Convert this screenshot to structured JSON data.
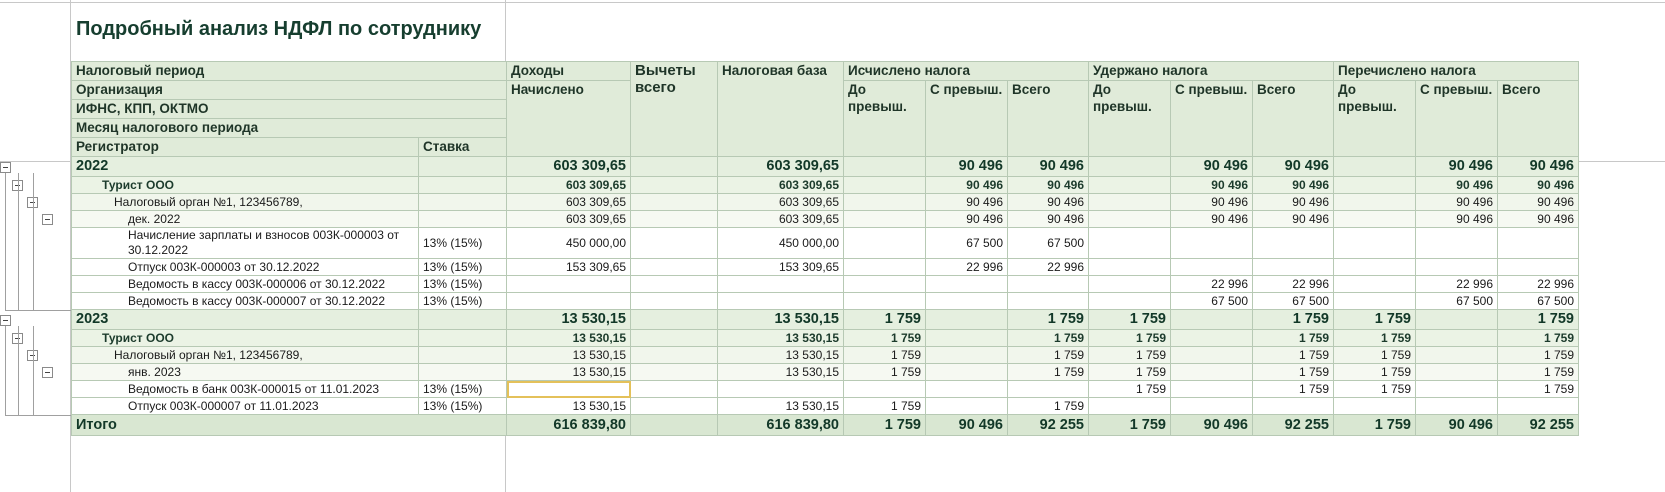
{
  "report": {
    "title": "Подробный анализ НДФЛ по сотруднику"
  },
  "headers": {
    "tax_period": "Налоговый период",
    "organization": "Организация",
    "ifns": "ИФНС, КПП, ОКТМО",
    "month": "Месяц налогового периода",
    "registrar": "Регистратор",
    "rate": "Ставка",
    "income": "Доходы",
    "accrued": "Начислено",
    "deductions": "Вычеты всего",
    "tax_base": "Налоговая база",
    "calculated": "Исчислено налога",
    "withheld": "Удержано налога",
    "transferred": "Перечислено налога",
    "before_excess": "До превыш.",
    "over_excess": "С превыш.",
    "total": "Всего"
  },
  "rows": [
    {
      "type": "lvl0",
      "label": "2022",
      "rate": "",
      "income": "603 309,65",
      "ded": "",
      "base": "603 309,65",
      "c1": "",
      "c2": "90 496",
      "c3": "90 496",
      "w1": "",
      "w2": "90 496",
      "w3": "90 496",
      "t1": "",
      "t2": "90 496",
      "t3": "90 496"
    },
    {
      "type": "lvl1",
      "label": "Турист ООО",
      "rate": "",
      "income": "603 309,65",
      "ded": "",
      "base": "603 309,65",
      "c1": "",
      "c2": "90 496",
      "c3": "90 496",
      "w1": "",
      "w2": "90 496",
      "w3": "90 496",
      "t1": "",
      "t2": "90 496",
      "t3": "90 496"
    },
    {
      "type": "lvl2",
      "label": "Налоговый орган №1, 123456789,",
      "rate": "",
      "income": "603 309,65",
      "ded": "",
      "base": "603 309,65",
      "c1": "",
      "c2": "90 496",
      "c3": "90 496",
      "w1": "",
      "w2": "90 496",
      "w3": "90 496",
      "t1": "",
      "t2": "90 496",
      "t3": "90 496"
    },
    {
      "type": "lvl3",
      "label": "дек. 2022",
      "rate": "",
      "income": "603 309,65",
      "ded": "",
      "base": "603 309,65",
      "c1": "",
      "c2": "90 496",
      "c3": "90 496",
      "w1": "",
      "w2": "90 496",
      "w3": "90 496",
      "t1": "",
      "t2": "90 496",
      "t3": "90 496"
    },
    {
      "type": "rowd",
      "label": "Начисление зарплаты и взносов 003К-000003 от 30.12.2022",
      "rate": "13% (15%)",
      "income": "450 000,00",
      "ded": "",
      "base": "450 000,00",
      "c1": "",
      "c2": "67 500",
      "c3": "67 500",
      "w1": "",
      "w2": "",
      "w3": "",
      "t1": "",
      "t2": "",
      "t3": ""
    },
    {
      "type": "rowd",
      "label": "Отпуск 003К-000003 от 30.12.2022",
      "rate": "13% (15%)",
      "income": "153 309,65",
      "ded": "",
      "base": "153 309,65",
      "c1": "",
      "c2": "22 996",
      "c3": "22 996",
      "w1": "",
      "w2": "",
      "w3": "",
      "t1": "",
      "t2": "",
      "t3": ""
    },
    {
      "type": "rowd",
      "label": "Ведомость в кассу 003К-000006 от 30.12.2022",
      "rate": "13% (15%)",
      "income": "",
      "ded": "",
      "base": "",
      "c1": "",
      "c2": "",
      "c3": "",
      "w1": "",
      "w2": "22 996",
      "w3": "22 996",
      "t1": "",
      "t2": "22 996",
      "t3": "22 996"
    },
    {
      "type": "rowd",
      "label": "Ведомость в кассу 003К-000007 от 30.12.2022",
      "rate": "13% (15%)",
      "income": "",
      "ded": "",
      "base": "",
      "c1": "",
      "c2": "",
      "c3": "",
      "w1": "",
      "w2": "67 500",
      "w3": "67 500",
      "t1": "",
      "t2": "67 500",
      "t3": "67 500"
    },
    {
      "type": "lvl0",
      "label": "2023",
      "rate": "",
      "income": "13 530,15",
      "ded": "",
      "base": "13 530,15",
      "c1": "1 759",
      "c2": "",
      "c3": "1 759",
      "w1": "1 759",
      "w2": "",
      "w3": "1 759",
      "t1": "1 759",
      "t2": "",
      "t3": "1 759"
    },
    {
      "type": "lvl1",
      "label": "Турист ООО",
      "rate": "",
      "income": "13 530,15",
      "ded": "",
      "base": "13 530,15",
      "c1": "1 759",
      "c2": "",
      "c3": "1 759",
      "w1": "1 759",
      "w2": "",
      "w3": "1 759",
      "t1": "1 759",
      "t2": "",
      "t3": "1 759"
    },
    {
      "type": "lvl2",
      "label": "Налоговый орган №1, 123456789,",
      "rate": "",
      "income": "13 530,15",
      "ded": "",
      "base": "13 530,15",
      "c1": "1 759",
      "c2": "",
      "c3": "1 759",
      "w1": "1 759",
      "w2": "",
      "w3": "1 759",
      "t1": "1 759",
      "t2": "",
      "t3": "1 759"
    },
    {
      "type": "lvl3",
      "label": "янв. 2023",
      "rate": "",
      "income": "13 530,15",
      "ded": "",
      "base": "13 530,15",
      "c1": "1 759",
      "c2": "",
      "c3": "1 759",
      "w1": "1 759",
      "w2": "",
      "w3": "1 759",
      "t1": "1 759",
      "t2": "",
      "t3": "1 759"
    },
    {
      "type": "rowd",
      "label": "Ведомость в банк 003К-000015 от 11.01.2023",
      "rate": "13% (15%)",
      "income": "",
      "ded": "",
      "base": "",
      "c1": "",
      "c2": "",
      "c3": "",
      "w1": "1 759",
      "w2": "",
      "w3": "1 759",
      "t1": "1 759",
      "t2": "",
      "t3": "1 759",
      "selected": true
    },
    {
      "type": "rowd",
      "label": "Отпуск 003К-000007 от 11.01.2023",
      "rate": "13% (15%)",
      "income": "13 530,15",
      "ded": "",
      "base": "13 530,15",
      "c1": "1 759",
      "c2": "",
      "c3": "1 759",
      "w1": "",
      "w2": "",
      "w3": "",
      "t1": "",
      "t2": "",
      "t3": ""
    }
  ],
  "total": {
    "label": "Итого",
    "income": "616 839,80",
    "ded": "",
    "base": "616 839,80",
    "c1": "1 759",
    "c2": "90 496",
    "c3": "92 255",
    "w1": "1 759",
    "w2": "90 496",
    "w3": "92 255",
    "t1": "1 759",
    "t2": "90 496",
    "t3": "92 255"
  }
}
